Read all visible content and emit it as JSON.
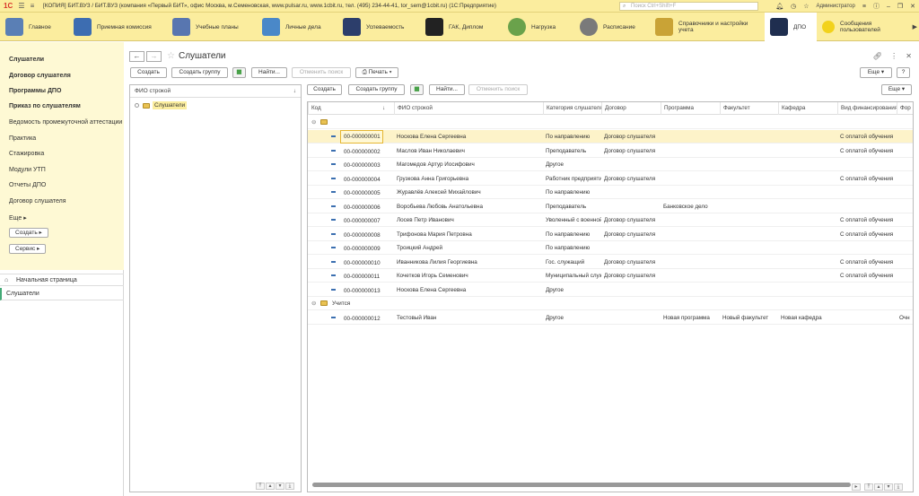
{
  "window": {
    "title": "[КОПИЯ] БИТ.ВУЗ / БИТ.ВУЗ (компания «Первый БИТ», офис Москва, м.Семеновская, www.pulsar.ru, www.1cbit.ru, тел. (495) 234-44-41, tor_sem@1cbit.ru)  (1С:Предприятие)",
    "logo": "1С",
    "search_placeholder": "Поиск Ctrl+Shift+F",
    "user": "Администратор"
  },
  "sections": [
    {
      "label": "Главное",
      "color": "#5a7fb5"
    },
    {
      "label": "Приемная комиссия",
      "color": "#3d6db1"
    },
    {
      "label": "Учебные планы",
      "color": "#5876b0"
    },
    {
      "label": "Личные дела",
      "color": "#4a88c8"
    },
    {
      "label": "Успеваемость",
      "color": "#2c3e6b"
    },
    {
      "label": "ГАК, Диплом",
      "color": "#222222"
    },
    {
      "label": "Нагрузка",
      "color": "#6aa24b"
    },
    {
      "label": "Расписание",
      "color": "#7a7a7a"
    },
    {
      "label": "Справочники и настройки учета",
      "color": "#c9a336"
    },
    {
      "label": "ДПО",
      "color": "#1f2e4f"
    },
    {
      "label": "Сообщения пользователей",
      "color": "#f2d21b"
    }
  ],
  "left_nav": {
    "items": [
      {
        "label": "Слушатели",
        "bold": true
      },
      {
        "label": "Договор слушателя",
        "bold": true
      },
      {
        "label": "Программы ДПО",
        "bold": true
      },
      {
        "label": "Приказ по слушателям",
        "bold": true
      },
      {
        "label": "Ведомость промежуточной аттестации",
        "bold": false
      },
      {
        "label": "Практика",
        "bold": false
      },
      {
        "label": "Стажировка",
        "bold": false
      },
      {
        "label": "Модули УТП",
        "bold": false
      },
      {
        "label": "Отчеты ДПО",
        "bold": false
      },
      {
        "label": "Договор слушателя",
        "bold": false
      },
      {
        "label": "Еще",
        "bold": false
      }
    ],
    "create_button": "Создать",
    "service_button": "Сервис",
    "home": "Начальная страница",
    "current": "Слушатели"
  },
  "page": {
    "title": "Слушатели"
  },
  "toolbar_top": {
    "create": "Создать",
    "create_group": "Создать группу",
    "find": "Найти...",
    "cancel_search": "Отменить поиск",
    "print": "Печать",
    "more": "Еще",
    "help": "?"
  },
  "tree": {
    "header": "ФИО строкой",
    "root": "Слушатели"
  },
  "toolbar_grid": {
    "create": "Создать",
    "create_group": "Создать группу",
    "find": "Найти...",
    "cancel_search": "Отменить поиск",
    "more": "Еще"
  },
  "grid": {
    "columns": [
      "Код",
      "ФИО строкой",
      "Категория слушателя",
      "Договор",
      "Программа",
      "Факультет",
      "Кафедра",
      "Вид финансирования",
      "Фор"
    ],
    "group_active": "Учится",
    "rows": [
      [
        "00-000000001",
        "Носкова Елена Сергеевна",
        "По направлению",
        "Договор слушателя",
        "",
        "",
        "",
        "С оплатой обучения",
        ""
      ],
      [
        "00-000000002",
        "Маслов Иван Николаевич",
        "Преподаватель",
        "Договор слушателя",
        "",
        "",
        "",
        "С оплатой обучения",
        ""
      ],
      [
        "00-000000003",
        "Магомедов Артур Иосифович",
        "Другое",
        "",
        "",
        "",
        "",
        "",
        ""
      ],
      [
        "00-000000004",
        "Грузкова Анна Григорьевна",
        "Работник предприятия",
        "Договор слушателя",
        "",
        "",
        "",
        "С оплатой обучения",
        ""
      ],
      [
        "00-000000005",
        "Журавлёв Алексей Михайлович",
        "По направлению",
        "",
        "",
        "",
        "",
        "",
        ""
      ],
      [
        "00-000000006",
        "Воробьева Любовь Анатольевна",
        "Преподаватель",
        "",
        "Банковское дело",
        "",
        "",
        "",
        ""
      ],
      [
        "00-000000007",
        "Лосев Петр Иванович",
        "Уволенный с военной службы",
        "Договор слушателя",
        "",
        "",
        "",
        "С оплатой обучения",
        ""
      ],
      [
        "00-000000008",
        "Трифонова Мария Петровна",
        "По направлению",
        "Договор слушателя",
        "",
        "",
        "",
        "С оплатой обучения",
        ""
      ],
      [
        "00-000000009",
        "Троицкий Андрей",
        "По направлению",
        "",
        "",
        "",
        "",
        "",
        ""
      ],
      [
        "00-000000010",
        "Иванникова Лилия Георгиевна",
        "Гос. служащий",
        "Договор слушателя",
        "",
        "",
        "",
        "С оплатой обучения",
        ""
      ],
      [
        "00-000000011",
        "Кочетков Игорь Семенович",
        "Муниципальный служащий",
        "Договор слушателя",
        "",
        "",
        "",
        "С оплатой обучения",
        ""
      ],
      [
        "00-000000013",
        "Носкова Елена Сергеевна",
        "Другое",
        "",
        "",
        "",
        "",
        "",
        ""
      ]
    ],
    "rows_group2": [
      [
        "00-000000012",
        "Тестовый Иван",
        "Другое",
        "",
        "Новая программа",
        "Новый факультет",
        "Новая кафедра",
        "",
        "Очн"
      ]
    ]
  }
}
